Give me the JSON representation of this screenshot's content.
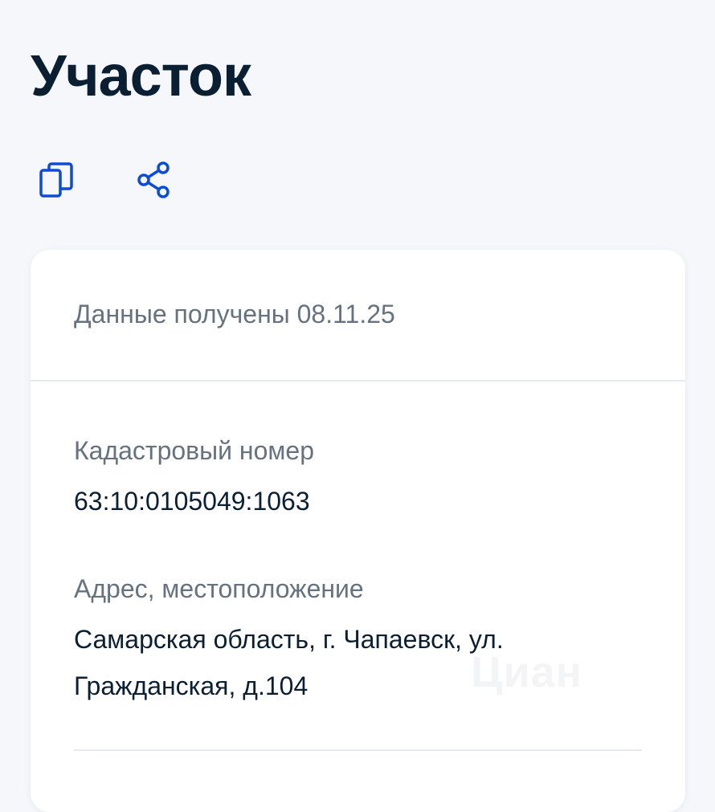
{
  "header": {
    "title": "Участок"
  },
  "actions": {
    "copy_icon": "copy-icon",
    "share_icon": "share-icon"
  },
  "card": {
    "received": "Данные получены 08.11.25",
    "fields": [
      {
        "label": "Кадастровый номер",
        "value": "63:10:0105049:1063"
      },
      {
        "label": "Адрес, местоположение",
        "value": "Самарская область, г. Чапаевск, ул. Гражданская, д.104"
      }
    ]
  },
  "watermark": "Циан",
  "colors": {
    "accent": "#0d4cd3",
    "text": "#0b1f33",
    "muted": "#66727f",
    "background": "#f5f7fb",
    "card": "#ffffff",
    "divider": "#e4e9ef"
  }
}
